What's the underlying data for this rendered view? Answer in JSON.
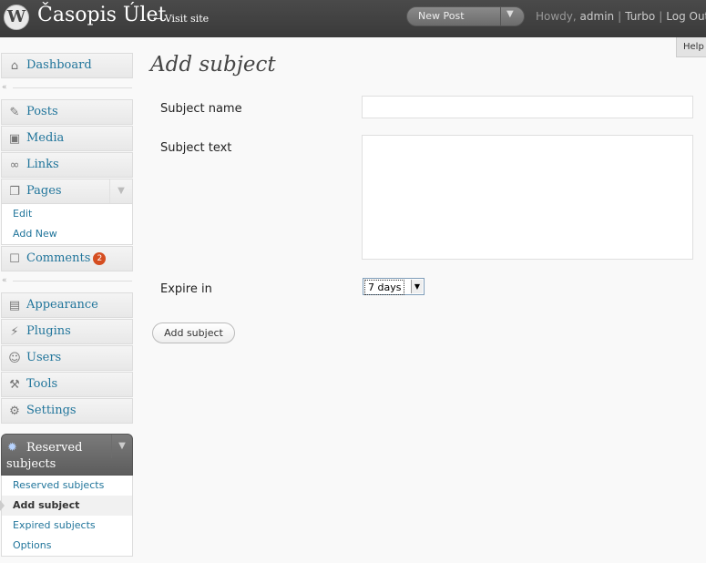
{
  "header": {
    "logo_letter": "W",
    "site_title": "Časopis Úlet",
    "visit_site": "← Visit site",
    "new_post_label": "New Post",
    "dropdown_arrow": "▼",
    "howdy": "Howdy, ",
    "user_name": "admin",
    "turbo": "Turbo",
    "logout": "Log Out",
    "separator": "|",
    "help": "Help"
  },
  "sidebar": {
    "dashboard": {
      "label": "Dashboard",
      "icon": "home-icon"
    },
    "collapse_glyph": "«",
    "posts": {
      "label": "Posts",
      "icon": "pin-icon"
    },
    "media": {
      "label": "Media",
      "icon": "media-icon"
    },
    "links": {
      "label": "Links",
      "icon": "link-icon"
    },
    "pages": {
      "label": "Pages",
      "icon": "pages-icon",
      "toggle": "▼",
      "submenu": [
        "Edit",
        "Add New"
      ]
    },
    "comments": {
      "label": "Comments",
      "icon": "comment-icon",
      "count": "2"
    },
    "appearance": {
      "label": "Appearance",
      "icon": "appearance-icon"
    },
    "plugins": {
      "label": "Plugins",
      "icon": "plugin-icon"
    },
    "users": {
      "label": "Users",
      "icon": "users-icon"
    },
    "tools": {
      "label": "Tools",
      "icon": "tools-icon"
    },
    "settings": {
      "label": "Settings",
      "icon": "settings-icon"
    },
    "reserved": {
      "label": "Reserved subjects",
      "icon": "gear-icon",
      "toggle": "▼",
      "submenu": [
        "Reserved subjects",
        "Add subject",
        "Expired subjects",
        "Options"
      ],
      "current": "Add subject"
    }
  },
  "main": {
    "title": "Add subject",
    "subject_name_label": "Subject name",
    "subject_name_value": "",
    "subject_text_label": "Subject text",
    "subject_text_value": "",
    "expire_label": "Expire in",
    "expire_value": "7 days",
    "expire_arrow": "▼",
    "submit_label": "Add subject"
  },
  "colors": {
    "header_bg": "#464646",
    "link": "#21759b",
    "badge": "#d54e21",
    "background": "#f9f9f9"
  }
}
